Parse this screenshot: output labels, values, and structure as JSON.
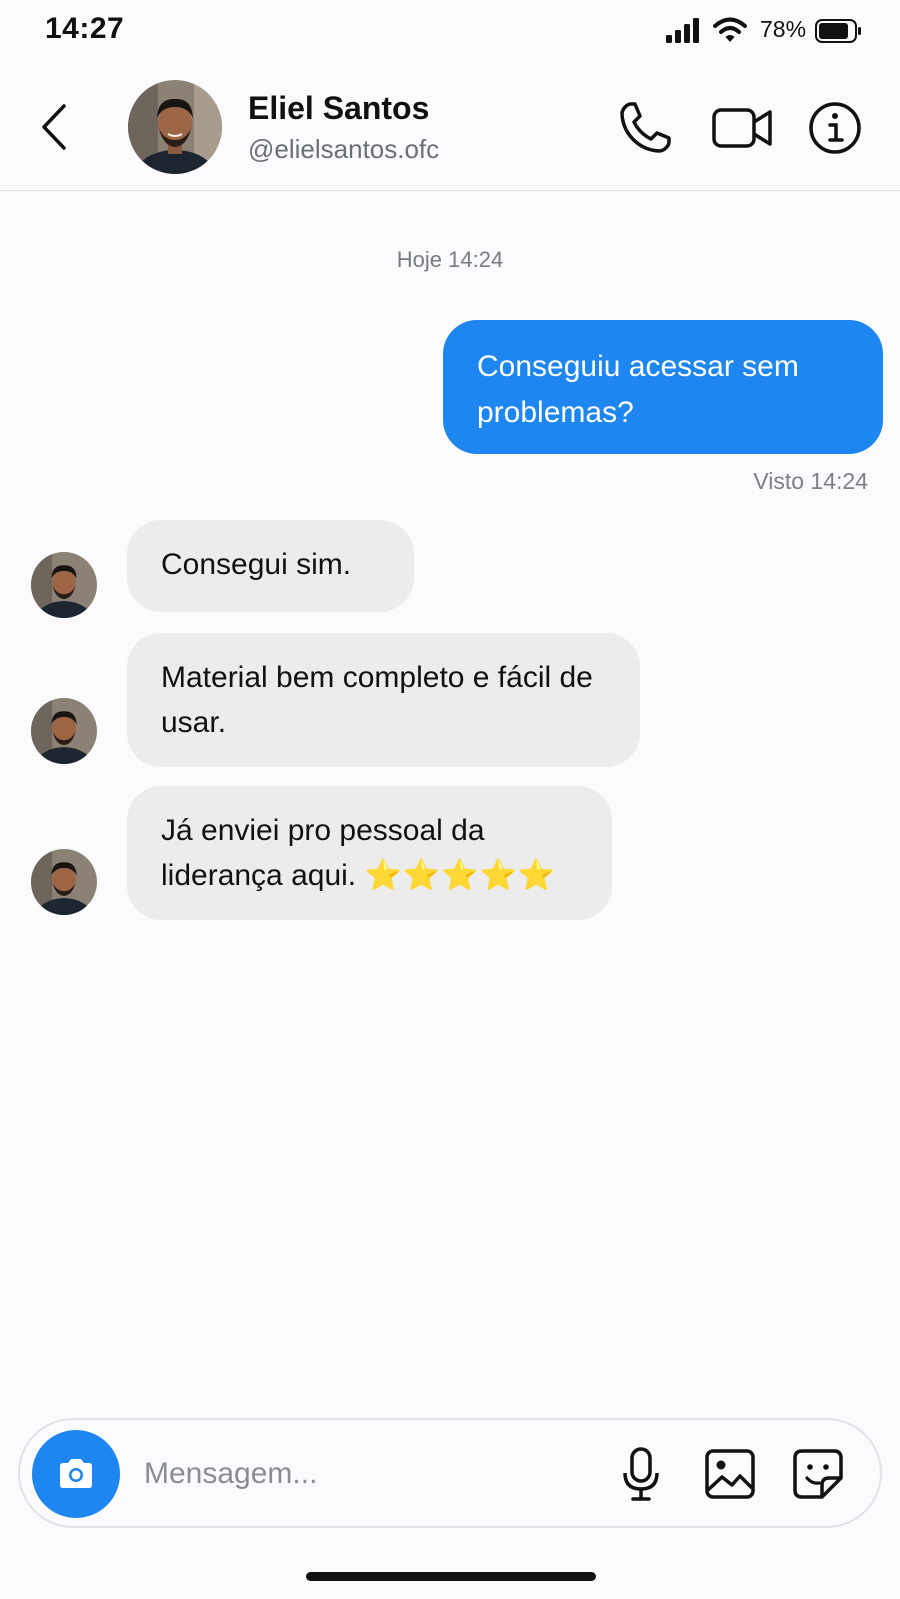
{
  "status_bar": {
    "time": "14:27",
    "battery_percent": "78%"
  },
  "header": {
    "contact_name": "Eliel Santos",
    "contact_handle": "@elielsantos.ofc"
  },
  "conversation": {
    "date_divider": "Hoje 14:24",
    "outgoing": [
      {
        "text": "Conseguiu acessar sem problemas?",
        "status": "Visto 14:24"
      }
    ],
    "incoming": [
      {
        "text": "Consegui sim."
      },
      {
        "text": "Material bem completo e fácil de usar."
      },
      {
        "text": "Já enviei pro pessoal da liderança aqui.",
        "stars": "⭐⭐⭐⭐⭐",
        "star_rating": 5
      }
    ]
  },
  "composer": {
    "placeholder": "Mensagem..."
  },
  "colors": {
    "accent": "#1e86f0",
    "incoming_bubble": "#ececec",
    "background": "#fbfbfd"
  },
  "icons": [
    "signal-icon",
    "wifi-icon",
    "battery-icon",
    "back-icon",
    "phone-icon",
    "video-camera-icon",
    "info-icon",
    "camera-icon",
    "microphone-icon",
    "gallery-icon",
    "sticker-icon"
  ]
}
